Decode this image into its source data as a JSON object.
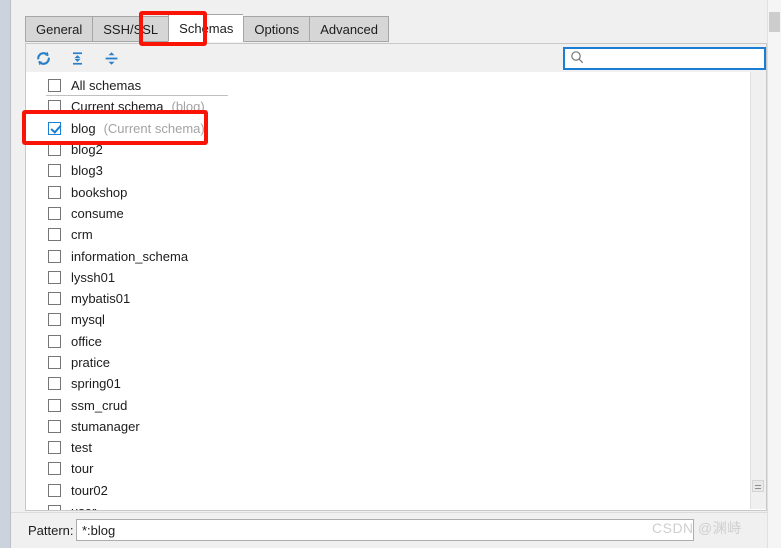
{
  "window": {
    "left_edge_name": "window-left-edge"
  },
  "tabs": [
    {
      "label": "General",
      "active": false
    },
    {
      "label": "SSH/SSL",
      "active": false
    },
    {
      "label": "Schemas",
      "active": true
    },
    {
      "label": "Options",
      "active": false
    },
    {
      "label": "Advanced",
      "active": false
    }
  ],
  "toolbar": {
    "icons": [
      {
        "name": "refresh-icon",
        "title": "Refresh"
      },
      {
        "name": "expand-all-icon",
        "title": "Expand All"
      },
      {
        "name": "collapse-all-icon",
        "title": "Collapse All"
      }
    ],
    "search": {
      "value": "",
      "placeholder": "",
      "icon": "search-icon"
    }
  },
  "schema_list": [
    {
      "label": "All schemas",
      "note": "",
      "checked": false,
      "separator": true
    },
    {
      "label": "Current schema",
      "note": "(blog)",
      "checked": false,
      "separator": false
    },
    {
      "label": "blog",
      "note": "(Current schema)",
      "checked": true,
      "separator": false
    },
    {
      "label": "blog2",
      "note": "",
      "checked": false,
      "separator": false
    },
    {
      "label": "blog3",
      "note": "",
      "checked": false,
      "separator": false
    },
    {
      "label": "bookshop",
      "note": "",
      "checked": false,
      "separator": false
    },
    {
      "label": "consume",
      "note": "",
      "checked": false,
      "separator": false
    },
    {
      "label": "crm",
      "note": "",
      "checked": false,
      "separator": false
    },
    {
      "label": "information_schema",
      "note": "",
      "checked": false,
      "separator": false
    },
    {
      "label": "lyssh01",
      "note": "",
      "checked": false,
      "separator": false
    },
    {
      "label": "mybatis01",
      "note": "",
      "checked": false,
      "separator": false
    },
    {
      "label": "mysql",
      "note": "",
      "checked": false,
      "separator": false
    },
    {
      "label": "office",
      "note": "",
      "checked": false,
      "separator": false
    },
    {
      "label": "pratice",
      "note": "",
      "checked": false,
      "separator": false
    },
    {
      "label": "spring01",
      "note": "",
      "checked": false,
      "separator": false
    },
    {
      "label": "ssm_crud",
      "note": "",
      "checked": false,
      "separator": false
    },
    {
      "label": "stumanager",
      "note": "",
      "checked": false,
      "separator": false
    },
    {
      "label": "test",
      "note": "",
      "checked": false,
      "separator": false
    },
    {
      "label": "tour",
      "note": "",
      "checked": false,
      "separator": false
    },
    {
      "label": "tour02",
      "note": "",
      "checked": false,
      "separator": false
    },
    {
      "label": "user",
      "note": "",
      "checked": false,
      "separator": false
    }
  ],
  "pattern": {
    "label": "Pattern:",
    "value": "*:blog",
    "placeholder": ""
  },
  "watermark": {
    "text": "CSDN @渊峙"
  },
  "annotations": [
    {
      "name": "annotation-schemas-tab",
      "color": "#fa1405"
    },
    {
      "name": "annotation-blog-row",
      "color": "#fa1405"
    }
  ]
}
